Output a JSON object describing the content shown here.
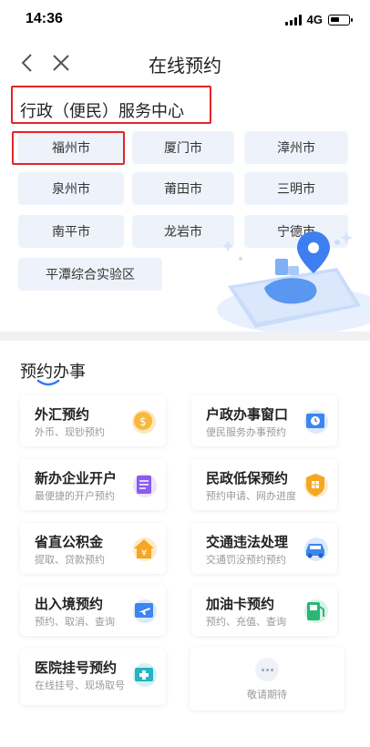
{
  "status": {
    "time": "14:36",
    "network": "4G",
    "battery_level": 0.55
  },
  "nav": {
    "title": "在线预约"
  },
  "service": {
    "title": "行政（便民）服务中心",
    "cities": [
      "福州市",
      "厦门市",
      "漳州市",
      "泉州市",
      "莆田市",
      "三明市",
      "南平市",
      "龙岩市",
      "宁德市",
      "平潭综合实验区"
    ]
  },
  "reserve": {
    "title": "预约办事",
    "cards": [
      {
        "title": "外汇预约",
        "subtitle": "外币、现钞预约",
        "icon": "coin-icon"
      },
      {
        "title": "户政办事窗口",
        "subtitle": "便民服务办事预约",
        "icon": "window-clock-icon"
      },
      {
        "title": "新办企业开户",
        "subtitle": "最便捷的开户预约",
        "icon": "document-stack-icon"
      },
      {
        "title": "民政低保预约",
        "subtitle": "预约申请、网办进度",
        "icon": "shield-grid-icon"
      },
      {
        "title": "省直公积金",
        "subtitle": "提取、贷款预约",
        "icon": "house-yen-icon"
      },
      {
        "title": "交通违法处理",
        "subtitle": "交通罚没预约预约",
        "icon": "car-icon"
      },
      {
        "title": "出入境预约",
        "subtitle": "预约、取消、查询",
        "icon": "airplane-ticket-icon"
      },
      {
        "title": "加油卡预约",
        "subtitle": "预约、充值、查询",
        "icon": "fuel-pump-icon"
      },
      {
        "title": "医院挂号预约",
        "subtitle": "在线挂号、现场取号",
        "icon": "medical-card-icon"
      }
    ],
    "more_label": "敬请期待"
  },
  "colors": {
    "accent": "#2f7cf6",
    "highlight": "#e0252a",
    "city_bg": "#eef3fb"
  }
}
